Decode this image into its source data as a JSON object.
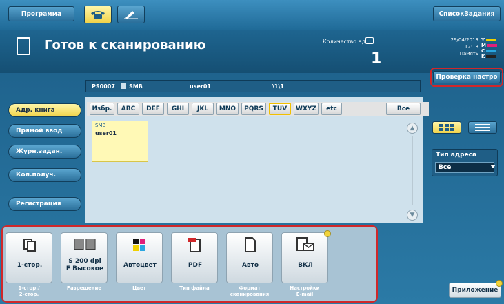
{
  "header": {
    "program_label": "Программа",
    "job_list_label": "СписокЗадания"
  },
  "status": {
    "title": "Готов к сканированию",
    "quantity_label": "Количество ад.",
    "quantity_value": "1",
    "date": "29/04/2013",
    "time": "12:18",
    "memory_label": "Память",
    "toner": [
      {
        "letter": "Y",
        "color": "#f0d000"
      },
      {
        "letter": "M",
        "color": "#e0207a"
      },
      {
        "letter": "C",
        "color": "#2aa6e0"
      },
      {
        "letter": "K",
        "color": "#222222"
      }
    ]
  },
  "path": {
    "server": "PS0007",
    "protocol": "SMB",
    "user": "user01",
    "folder": "\\1\\1"
  },
  "check_settings_label": "Проверка настро",
  "nav": [
    {
      "label": "Адр. книга",
      "active": true
    },
    {
      "label": "Прямой ввод",
      "active": false
    },
    {
      "label": "Журн.задан.",
      "active": false
    },
    {
      "label": "Кол.получ.",
      "active": false
    },
    {
      "label": "Регистрация",
      "active": false
    }
  ],
  "index_tabs": [
    "Избр.",
    "ABC",
    "DEF",
    "GHI",
    "JKL",
    "MNO",
    "PQRS",
    "TUV",
    "WXYZ",
    "etc",
    "Все"
  ],
  "selected_tab": "TUV",
  "entries": [
    {
      "type": "SMB",
      "name": "user01"
    }
  ],
  "address_type": {
    "title": "Тип адреса",
    "value": "Все"
  },
  "settings": [
    {
      "icon": "duplex-icon",
      "value": "1-стор.",
      "caption": "1-стор./\n2-стор."
    },
    {
      "icon": "resolution-icon",
      "value": "S 200 dpi\nF Высокое",
      "caption": "Разрешение"
    },
    {
      "icon": "color-icon",
      "value": "Автоцвет",
      "caption": "Цвет"
    },
    {
      "icon": "pdf-icon",
      "value": "PDF",
      "caption": "Тип файла"
    },
    {
      "icon": "paper-size-icon",
      "value": "Авто",
      "caption": "Формат\nсканирования"
    },
    {
      "icon": "email-icon",
      "value": "ВКЛ",
      "caption": "Настройки\nE-mail"
    }
  ],
  "apps_label": "Приложение"
}
